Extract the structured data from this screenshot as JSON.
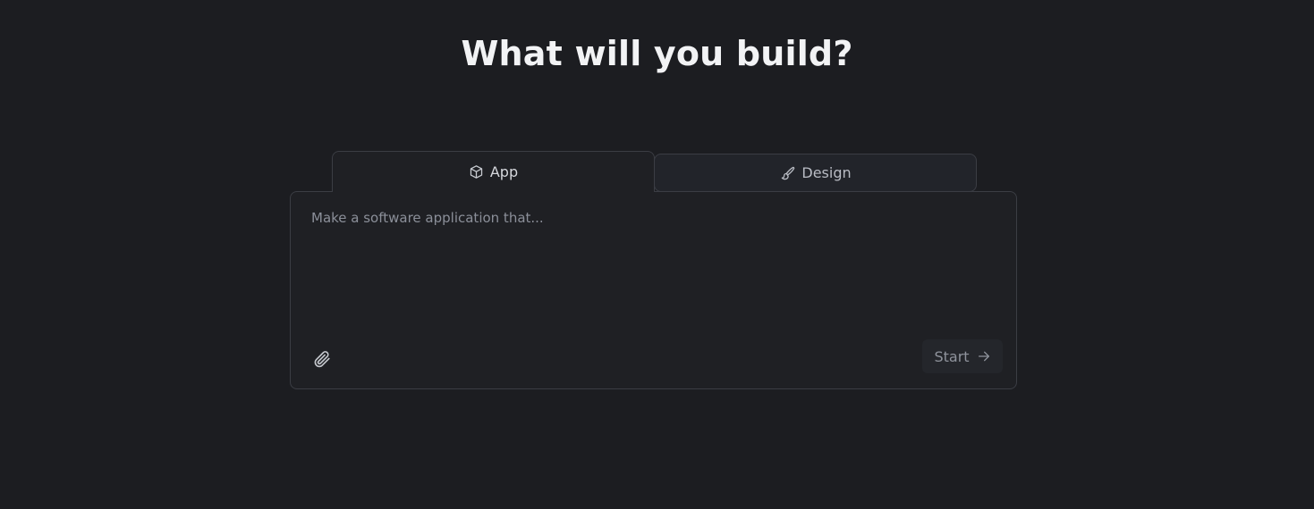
{
  "heading": "What will you build?",
  "tabs": [
    {
      "label": "App",
      "icon": "cube-icon",
      "active": true
    },
    {
      "label": "Design",
      "icon": "paintbrush-icon",
      "active": false
    }
  ],
  "prompt": {
    "value": "",
    "placeholder": "Make a software application that..."
  },
  "attach_icon": "paperclip-icon",
  "start_button": {
    "label": "Start",
    "icon": "arrow-right-icon"
  },
  "colors": {
    "background": "#1c1d21",
    "panel": "#1f2024",
    "border": "#3b3d44",
    "heading": "#f2f3f5",
    "muted": "#8b8f99"
  }
}
